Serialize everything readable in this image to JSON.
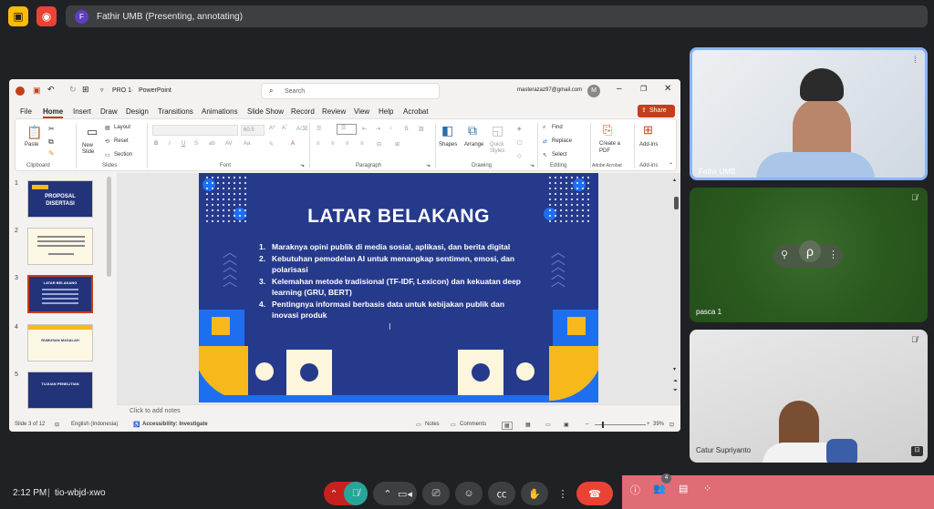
{
  "meet": {
    "presenter_initial": "F",
    "presenter_banner": "Fathir UMB (Presenting, annotating)",
    "time": "2:12 PM",
    "meeting_code": "tio-wbjd-xwo",
    "participant_count": "4",
    "tiles": [
      {
        "name": "Fathir UMB"
      },
      {
        "name": "pasca 1"
      },
      {
        "name": "Catur Supriyanto"
      }
    ]
  },
  "ppt": {
    "doc_name": "PRO 1",
    "app_name": "PowerPoint",
    "search_placeholder": "Search",
    "account": "masterazaz97@gmail.com",
    "account_initial": "M",
    "menu": [
      "File",
      "Home",
      "Insert",
      "Draw",
      "Design",
      "Transitions",
      "Animations",
      "Slide Show",
      "Record",
      "Review",
      "View",
      "Help",
      "Acrobat"
    ],
    "share_label": "Share",
    "ribbon": {
      "paste": "Paste",
      "clipboard": "Clipboard",
      "new_slide": "New Slide",
      "layout": "Layout",
      "reset": "Reset",
      "section": "Section",
      "slides": "Slides",
      "font_size": "60.5",
      "font": "Font",
      "paragraph": "Paragraph",
      "shapes": "Shapes",
      "arrange": "Arrange",
      "quick_styles": "Quick Styles",
      "drawing": "Drawing",
      "find": "Find",
      "replace": "Replace",
      "select": "Select",
      "editing": "Editing",
      "create_pdf": "Create a PDF",
      "adobe_acrobat": "Adobe Acrobat",
      "addins": "Add-ins",
      "addins_grp": "Add-ins"
    },
    "thumbnails": [
      {
        "num": "1",
        "title": "PROPOSAL DISERTASI"
      },
      {
        "num": "2",
        "title": ""
      },
      {
        "num": "3",
        "title": "LATAR BELAKANG"
      },
      {
        "num": "4",
        "title": "RUMUSAN MASALAH"
      },
      {
        "num": "5",
        "title": "TUJUAN PENELITIAN"
      }
    ],
    "slide": {
      "title": "LATAR BELAKANG",
      "items": [
        {
          "n": "1.",
          "text": "Maraknya opini publik di media sosial, aplikasi, dan berita digital"
        },
        {
          "n": "2.",
          "text": "Kebutuhan pemodelan AI untuk menangkap sentimen, emosi, dan polarisasi"
        },
        {
          "n": "3.",
          "text": "Kelemahan metode tradisional (TF-IDF, Lexicon) dan kekuatan deep learning (GRU, BERT)"
        },
        {
          "n": "4.",
          "text": "Pentingnya informasi berbasis data untuk kebijakan publik dan inovasi produk"
        }
      ]
    },
    "notes_placeholder": "Click to add notes",
    "status": {
      "slide_of": "Slide 3 of 12",
      "language": "English (Indonesia)",
      "accessibility": "Accessibility: Investigate",
      "notes": "Notes",
      "comments": "Comments",
      "zoom": "39%"
    }
  },
  "colors": {
    "slide_bg": "#263a8c",
    "accent_yellow": "#f7b81c",
    "accent_blue": "#1e6ff0",
    "end_call": "#ea4335",
    "ppt_red": "#c43e1c"
  }
}
